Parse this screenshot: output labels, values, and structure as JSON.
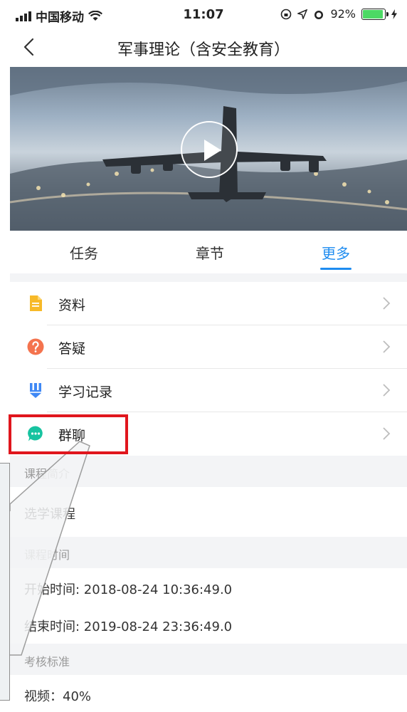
{
  "status_bar": {
    "carrier": "中国移动",
    "time": "11:07",
    "battery_pct": "92%",
    "battery_level": 0.92
  },
  "nav": {
    "title": "军事理论（含安全教育）"
  },
  "tabs": [
    {
      "label": "任务",
      "active": false
    },
    {
      "label": "章节",
      "active": false
    },
    {
      "label": "更多",
      "active": true
    }
  ],
  "menu": [
    {
      "label": "资料",
      "icon": "file-icon",
      "color": "#f7b928"
    },
    {
      "label": "答疑",
      "icon": "question-icon",
      "color": "#f4734e"
    },
    {
      "label": "学习记录",
      "icon": "study-record-icon",
      "color": "#3f88f5"
    },
    {
      "label": "群聊",
      "icon": "chat-icon",
      "color": "#17c3a0"
    }
  ],
  "sections": {
    "intro_head": "课程简介",
    "intro_body": "选学课程",
    "time_head": "课程时间",
    "start_time": "开始时间: 2018-08-24 10:36:49.0",
    "end_time": "结束时间: 2019-08-24 23:36:49.0",
    "assess_head": "考核标准",
    "assess_video": "视频：40%"
  },
  "colors": {
    "accent": "#1e8cf0",
    "highlight": "#e0161d"
  }
}
